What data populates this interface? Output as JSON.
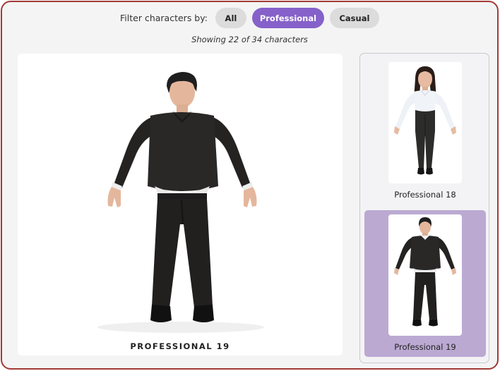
{
  "filter": {
    "label": "Filter characters by:",
    "options": [
      {
        "label": "All",
        "active": false
      },
      {
        "label": "Professional",
        "active": true
      },
      {
        "label": "Casual",
        "active": false
      }
    ]
  },
  "status": {
    "showing_text": "Showing 22 of 34 characters",
    "shown": 22,
    "total": 34
  },
  "main_preview": {
    "name": "PROFESSIONAL 19"
  },
  "thumbnails": [
    {
      "label": "Professional 18",
      "selected": false
    },
    {
      "label": "Professional 19",
      "selected": true
    }
  ],
  "colors": {
    "active_filter": "#8561c9",
    "selected_thumbnail": "#bba9d2",
    "frame_border": "#a33a36"
  }
}
